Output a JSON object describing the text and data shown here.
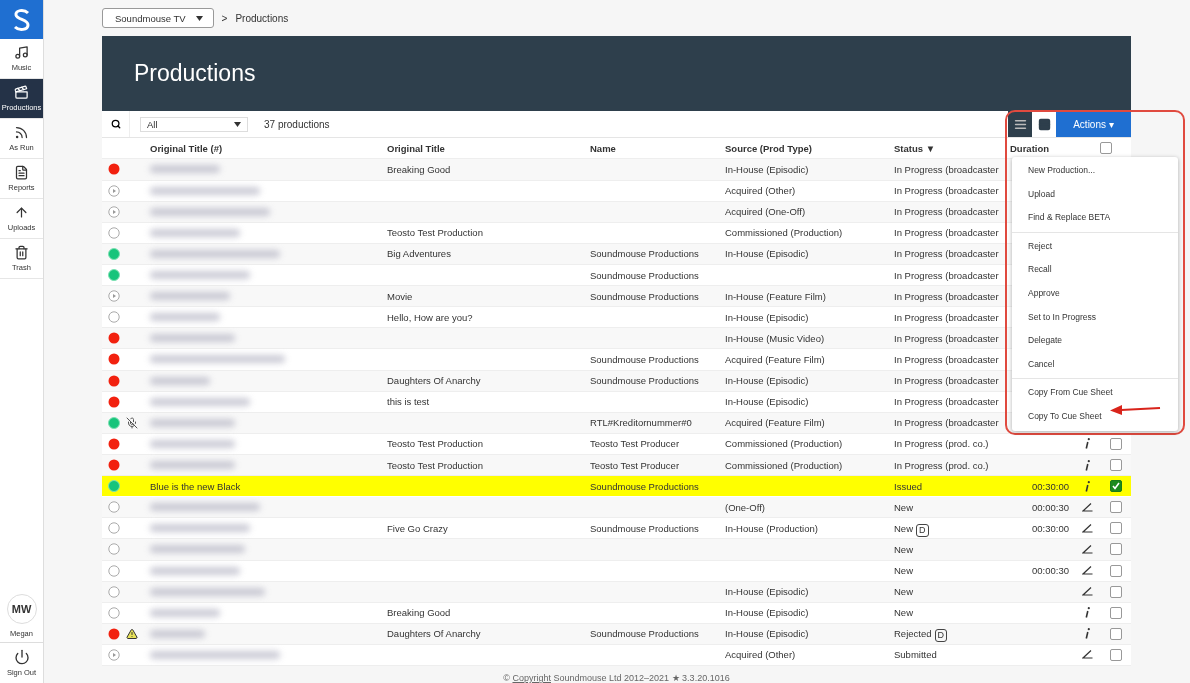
{
  "sidebar": {
    "items": [
      {
        "label": "Music",
        "selected": false
      },
      {
        "label": "Productions",
        "selected": true
      },
      {
        "label": "As Run",
        "selected": false
      },
      {
        "label": "Reports",
        "selected": false
      },
      {
        "label": "Uploads",
        "selected": false
      },
      {
        "label": "Trash",
        "selected": false
      }
    ],
    "user": {
      "initials": "MW",
      "name": "Megan"
    },
    "sign_out": "Sign Out"
  },
  "breadcrumb": {
    "account": "Soundmouse TV",
    "separator": ">",
    "current": "Productions"
  },
  "page_title": "Productions",
  "toolbar": {
    "filter": "All",
    "count": "37 productions",
    "views": [
      {
        "kind": "list",
        "selected": true
      },
      {
        "kind": "split",
        "selected": false
      }
    ],
    "actions": "Actions",
    "actions_caret": "▾"
  },
  "table": {
    "columns": [
      "Original Title (#)",
      "Original Title",
      "Name",
      "Source (Prod Type)",
      "Status ▼",
      "Duration"
    ],
    "select_all": {
      "checked": false
    },
    "rows": [
      {
        "kind": "red",
        "muted": false,
        "warning": false,
        "title_redacted": true,
        "original_title": "Breaking Good",
        "source": "In-House (Episodic)",
        "status": "In Progress (broadcaster"
      },
      {
        "kind": "play",
        "muted": false,
        "warning": false,
        "title_redacted": true,
        "source": "Acquired (Other)",
        "status": "In Progress (broadcaster"
      },
      {
        "kind": "play",
        "muted": false,
        "warning": false,
        "title_redacted": true,
        "source": "Acquired (One-Off)",
        "status": "In Progress (broadcaster"
      },
      {
        "kind": "empty",
        "muted": false,
        "warning": false,
        "title_redacted": true,
        "original_title": "Teosto Test Production",
        "source": "Commissioned (Production)",
        "status": "In Progress (broadcaster"
      },
      {
        "kind": "green",
        "muted": false,
        "warning": false,
        "title_redacted": true,
        "original_title": "Big Adventures",
        "name": "Soundmouse Productions",
        "source": "In-House (Episodic)",
        "status": "In Progress (broadcaster"
      },
      {
        "kind": "green",
        "muted": false,
        "warning": false,
        "title_redacted": true,
        "name": "Soundmouse Productions",
        "status": "In Progress (broadcaster"
      },
      {
        "kind": "play",
        "muted": false,
        "warning": false,
        "title_redacted": true,
        "original_title": "Movie",
        "name": "Soundmouse Productions",
        "source": "In-House (Feature Film)",
        "status": "In Progress (broadcaster"
      },
      {
        "kind": "empty",
        "muted": false,
        "warning": false,
        "title_redacted": true,
        "original_title": "Hello, How are you?",
        "source": "In-House (Episodic)",
        "status": "In Progress (broadcaster"
      },
      {
        "kind": "red",
        "muted": false,
        "warning": false,
        "title_redacted": true,
        "source": "In-House (Music Video)",
        "status": "In Progress (broadcaster"
      },
      {
        "kind": "red",
        "muted": false,
        "warning": false,
        "title_redacted": true,
        "name": "Soundmouse Productions",
        "source": "Acquired (Feature Film)",
        "status": "In Progress (broadcaster"
      },
      {
        "kind": "red",
        "muted": false,
        "warning": false,
        "title_redacted": true,
        "original_title": "Daughters Of Anarchy",
        "name": "Soundmouse Productions",
        "source": "In-House (Episodic)",
        "status": "In Progress (broadcaster"
      },
      {
        "kind": "red",
        "muted": false,
        "warning": false,
        "title_redacted": true,
        "original_title": "this is test",
        "source": "In-House (Episodic)",
        "status": "In Progress (broadcaster"
      },
      {
        "kind": "green",
        "muted": true,
        "warning": false,
        "title_redacted": true,
        "name": "RTL#Kreditornummer#0",
        "source": "Acquired (Feature Film)",
        "status": "In Progress (broadcaster"
      },
      {
        "kind": "red",
        "muted": false,
        "warning": false,
        "title_redacted": true,
        "original_title": "Teosto Test Production",
        "name": "Teosto Test Producer",
        "source": "Commissioned (Production)",
        "status": "In Progress (prod. co.)",
        "editable": false,
        "checked": false,
        "selected": false
      },
      {
        "kind": "red",
        "muted": false,
        "warning": false,
        "title_redacted": true,
        "original_title": "Teosto Test Production",
        "name": "Teosto Test Producer",
        "source": "Commissioned (Production)",
        "status": "In Progress (prod. co.)",
        "editable": false,
        "checked": false,
        "selected": false
      },
      {
        "kind": "green",
        "muted": false,
        "warning": false,
        "title_redacted": false,
        "title": "Blue is the new Black",
        "name": "Soundmouse Productions",
        "status": "Issued",
        "duration": "00:30:00",
        "editable": false,
        "checked": true,
        "selected": true
      },
      {
        "kind": "empty",
        "muted": false,
        "warning": false,
        "title_redacted": true,
        "source": "(One-Off)",
        "status": "New",
        "duration": "00:00:30",
        "editable": true,
        "checked": false,
        "selected": false
      },
      {
        "kind": "empty",
        "muted": false,
        "warning": false,
        "title_redacted": true,
        "original_title": "Five Go Crazy",
        "name": "Soundmouse Productions",
        "source": "In-House (Production)",
        "status": "New",
        "badge": "D",
        "duration": "00:30:00",
        "editable": true,
        "checked": false,
        "selected": false
      },
      {
        "kind": "empty",
        "muted": false,
        "warning": false,
        "title_redacted": true,
        "status": "New",
        "editable": true,
        "checked": false,
        "selected": false
      },
      {
        "kind": "empty",
        "muted": false,
        "warning": false,
        "title_redacted": true,
        "status": "New",
        "duration": "00:00:30",
        "editable": true,
        "checked": false,
        "selected": false
      },
      {
        "kind": "empty",
        "muted": false,
        "warning": false,
        "title_redacted": true,
        "source": "In-House (Episodic)",
        "status": "New",
        "editable": true,
        "checked": false,
        "selected": false
      },
      {
        "kind": "empty",
        "muted": false,
        "warning": false,
        "title_redacted": true,
        "original_title": "Breaking Good",
        "source": "In-House (Episodic)",
        "status": "New",
        "editable": false,
        "checked": false,
        "selected": false
      },
      {
        "kind": "red",
        "muted": false,
        "warning": true,
        "title_redacted": true,
        "original_title": "Daughters Of Anarchy",
        "name": "Soundmouse Productions",
        "source": "In-House (Episodic)",
        "status": "Rejected",
        "badge": "D",
        "editable": false,
        "checked": false,
        "selected": false
      },
      {
        "kind": "play",
        "muted": false,
        "warning": false,
        "title_redacted": true,
        "source": "Acquired (Other)",
        "status": "Submitted",
        "editable": true,
        "checked": false,
        "selected": false
      }
    ]
  },
  "actions_menu": [
    [
      "New Production...",
      "Upload",
      "Find & Replace BETA"
    ],
    [
      "Reject",
      "Recall",
      "Approve",
      "Set to In Progress",
      "Delegate",
      "Cancel"
    ],
    [
      "Copy From Cue Sheet",
      "Copy To Cue Sheet"
    ]
  ],
  "footer": {
    "prefix": "©",
    "link": "Copyright",
    "text": "Soundmouse Ltd 2012–2021 ★ 3.3.20.1016"
  }
}
